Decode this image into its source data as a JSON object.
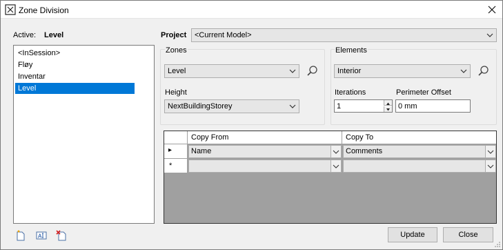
{
  "window": {
    "title": "Zone Division"
  },
  "active": {
    "label": "Active:",
    "value": "Level"
  },
  "zone_list": {
    "items": [
      "<InSession>",
      "Fløy",
      "Inventar",
      "Level"
    ],
    "selected_index": 3
  },
  "project": {
    "label": "Project",
    "value": "<Current Model>"
  },
  "zones": {
    "group_label": "Zones",
    "zone_value": "Level",
    "height_label": "Height",
    "height_value": "NextBuildingStorey"
  },
  "elements": {
    "group_label": "Elements",
    "element_value": "Interior",
    "iterations_label": "Iterations",
    "iterations_value": "1",
    "perimeter_label": "Perimeter Offset",
    "perimeter_value": "0 mm"
  },
  "mapping_grid": {
    "columns": [
      "Copy From",
      "Copy To"
    ],
    "rows": [
      {
        "marker": "▸",
        "copy_from": "Name",
        "copy_to": "Comments"
      },
      {
        "marker": "*",
        "copy_from": "",
        "copy_to": ""
      }
    ]
  },
  "buttons": {
    "update": "Update",
    "close": "Close"
  },
  "toolbar_icons": [
    "new-zone-icon",
    "rename-zone-icon",
    "delete-zone-icon"
  ]
}
